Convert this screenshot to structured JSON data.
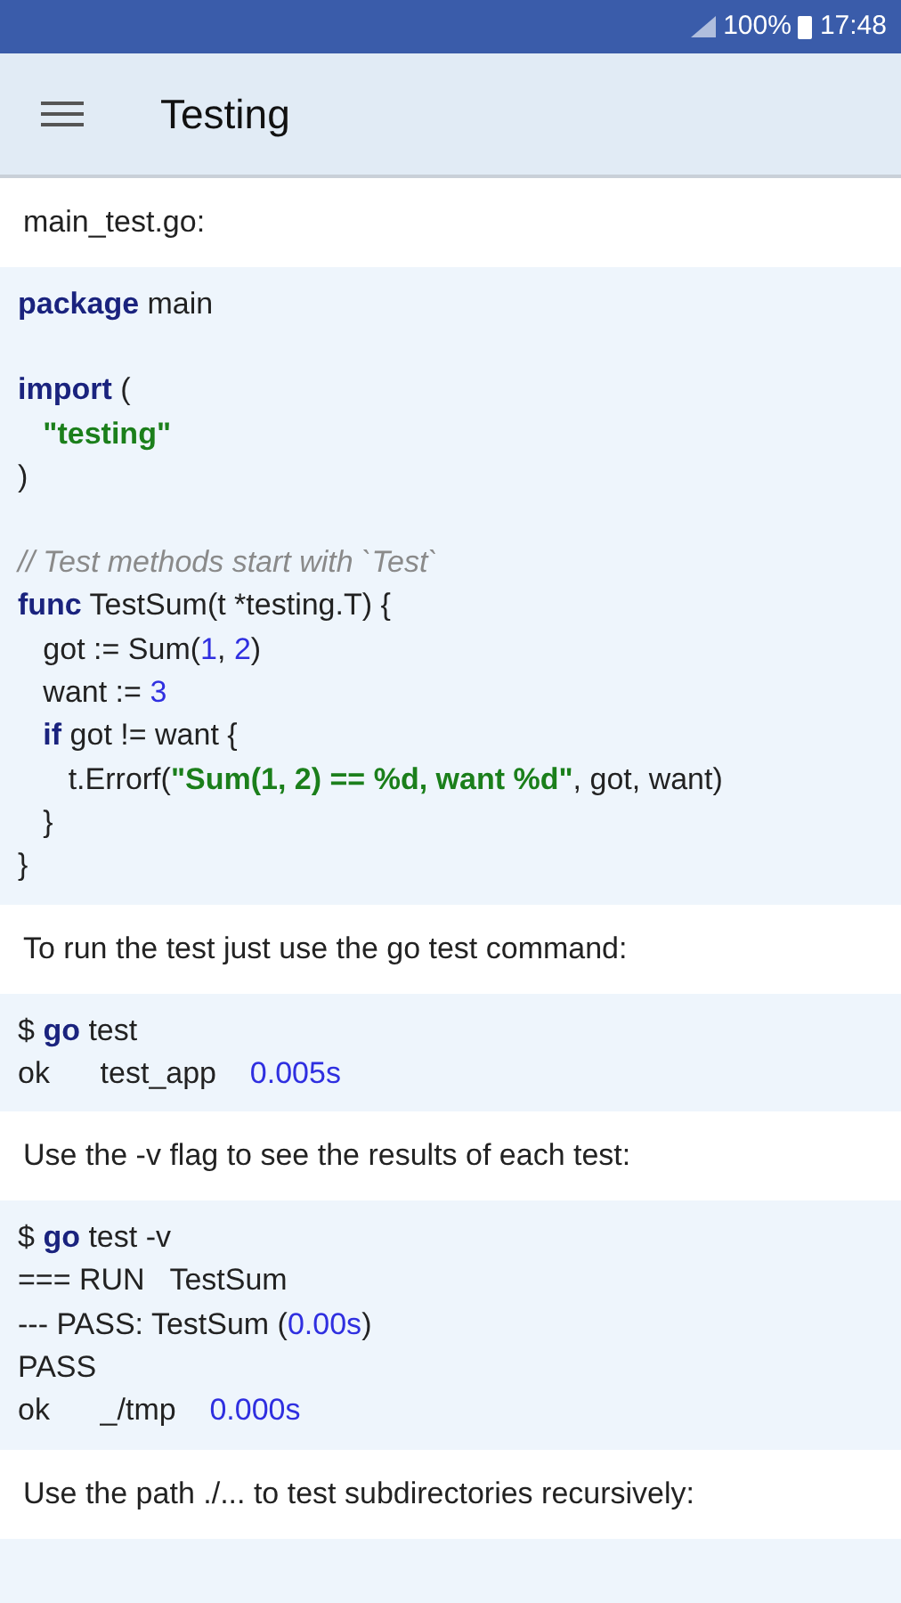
{
  "status_bar": {
    "battery": "100%",
    "time": "17:48"
  },
  "app_bar": {
    "title": "Testing"
  },
  "content": [
    {
      "kind": "text",
      "text": "main_test.go:"
    },
    {
      "kind": "code",
      "lines": [
        {
          "tokens": [
            {
              "text": "package",
              "kind": "keyword"
            },
            {
              "text": " main",
              "kind": "plain"
            }
          ]
        },
        {
          "kind": "blank"
        },
        {
          "tokens": [
            {
              "text": "import",
              "kind": "keyword"
            },
            {
              "text": " (",
              "kind": "plain"
            }
          ]
        },
        {
          "tokens": [
            {
              "text": "   \"testing\"",
              "kind": "string"
            }
          ]
        },
        {
          "tokens": [
            {
              "text": ")",
              "kind": "plain"
            }
          ]
        },
        {
          "kind": "blank"
        },
        {
          "tokens": [
            {
              "text": "// Test methods start with `Test`",
              "kind": "comment"
            }
          ]
        },
        {
          "tokens": [
            {
              "text": "func",
              "kind": "keyword"
            },
            {
              "text": " TestSum(t *testing.T) {",
              "kind": "plain"
            }
          ]
        },
        {
          "tokens": [
            {
              "text": "   got := Sum(",
              "kind": "plain"
            },
            {
              "text": "1",
              "kind": "number"
            },
            {
              "text": ", ",
              "kind": "plain"
            },
            {
              "text": "2",
              "kind": "number"
            },
            {
              "text": ")",
              "kind": "plain"
            }
          ]
        },
        {
          "tokens": [
            {
              "text": "   want := ",
              "kind": "plain"
            },
            {
              "text": "3",
              "kind": "number"
            }
          ]
        },
        {
          "tokens": [
            {
              "text": "   if",
              "kind": "keyword"
            },
            {
              "text": " got != want {",
              "kind": "plain"
            }
          ]
        },
        {
          "tokens": [
            {
              "text": "      t.Errorf(",
              "kind": "plain"
            },
            {
              "text": "\"Sum(1, 2) == %d, want %d\"",
              "kind": "string"
            },
            {
              "text": ", got, want)",
              "kind": "plain"
            }
          ]
        },
        {
          "tokens": [
            {
              "text": "   }",
              "kind": "plain"
            }
          ]
        },
        {
          "tokens": [
            {
              "text": "}",
              "kind": "plain"
            }
          ]
        }
      ]
    },
    {
      "kind": "text",
      "text": "To run the test just use the go test command:"
    },
    {
      "kind": "code",
      "lines": [
        {
          "tokens": [
            {
              "text": "$ ",
              "kind": "plain"
            },
            {
              "text": "go",
              "kind": "keyword"
            },
            {
              "text": " test",
              "kind": "plain"
            }
          ]
        },
        {
          "tokens": [
            {
              "text": "ok      test_app    ",
              "kind": "plain"
            },
            {
              "text": "0.005s",
              "kind": "number"
            }
          ]
        }
      ]
    },
    {
      "kind": "text",
      "text": "Use the -v flag to see the results of each test:"
    },
    {
      "kind": "code",
      "lines": [
        {
          "tokens": [
            {
              "text": "$ ",
              "kind": "plain"
            },
            {
              "text": "go",
              "kind": "keyword"
            },
            {
              "text": " test -v",
              "kind": "plain"
            }
          ]
        },
        {
          "tokens": [
            {
              "text": "=== RUN   TestSum",
              "kind": "plain"
            }
          ]
        },
        {
          "tokens": [
            {
              "text": "--- PASS: TestSum (",
              "kind": "plain"
            },
            {
              "text": "0.00s",
              "kind": "number"
            },
            {
              "text": ")",
              "kind": "plain"
            }
          ]
        },
        {
          "tokens": [
            {
              "text": "PASS",
              "kind": "plain"
            }
          ]
        },
        {
          "tokens": [
            {
              "text": "ok      _/tmp    ",
              "kind": "plain"
            },
            {
              "text": "0.000s",
              "kind": "number"
            }
          ]
        }
      ]
    },
    {
      "kind": "text",
      "text": "Use the path ./... to test subdirectories recursively:"
    }
  ]
}
